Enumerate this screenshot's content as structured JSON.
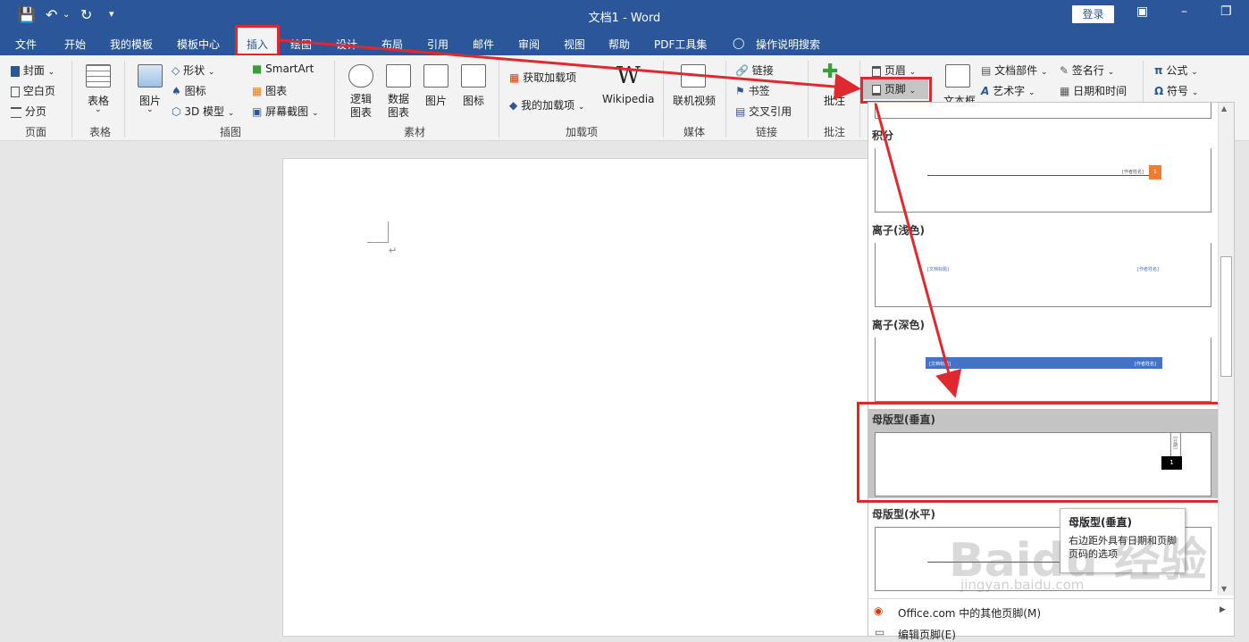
{
  "titlebar": {
    "doc_title": "文档1  -  Word",
    "login": "登录"
  },
  "tabs": [
    "文件",
    "开始",
    "我的模板",
    "模板中心",
    "插入",
    "绘图",
    "设计",
    "布局",
    "引用",
    "邮件",
    "审阅",
    "视图",
    "帮助",
    "PDF工具集"
  ],
  "tell_me": "操作说明搜索",
  "ribbon": {
    "pages": {
      "cover": "封面",
      "blank": "空白页",
      "break": "分页",
      "group": "页面"
    },
    "tables": {
      "table": "表格",
      "group": "表格"
    },
    "illus": {
      "picture": "图片",
      "shapes": "形状",
      "icons": "图标",
      "model": "3D 模型",
      "smartart": "SmartArt",
      "chart": "图表",
      "screenshot": "屏幕截图",
      "group": "插图"
    },
    "material": {
      "logic1": "逻辑",
      "logic2": "图表",
      "data1": "数据",
      "data2": "图表",
      "picture": "图片",
      "icon": "图标",
      "group": "素材"
    },
    "addins": {
      "get": "获取加载项",
      "mine": "我的加载项",
      "wiki": "Wikipedia",
      "group": "加载项"
    },
    "media": {
      "video": "联机视频",
      "group": "媒体"
    },
    "links": {
      "link": "链接",
      "bookmark": "书签",
      "crossref": "交叉引用",
      "group": "链接"
    },
    "comments": {
      "comment": "批注",
      "group": "批注"
    },
    "hf": {
      "header": "页眉",
      "footer": "页脚"
    },
    "text": {
      "textbox": "文本框",
      "parts": "文档部件",
      "wordart": "艺术字",
      "sigline": "签名行",
      "datetime": "日期和时间"
    },
    "symbols": {
      "equation": "公式",
      "symbol": "符号"
    }
  },
  "gallery": {
    "items": [
      {
        "label": "积分"
      },
      {
        "label": "离子(浅色)",
        "left": "[文档标题]",
        "right": "[作者姓名]"
      },
      {
        "label": "离子(深色)",
        "left": "[文档标题]",
        "right": "[作者姓名]"
      },
      {
        "label": "母版型(垂直)",
        "page": "1",
        "side": "[日期]"
      },
      {
        "label": "母版型(水平)"
      }
    ],
    "integral_author": "[作者姓名]",
    "integral_page": "1",
    "more": "Office.com 中的其他页脚(M)",
    "edit": "编辑页脚(E)"
  },
  "tooltip": {
    "title": "母版型(垂直)",
    "body": "右边距外具有日期和页脚页码的选项"
  },
  "watermark": {
    "main": "Baidu 经验",
    "sub": "jingyan.baidu.com"
  }
}
